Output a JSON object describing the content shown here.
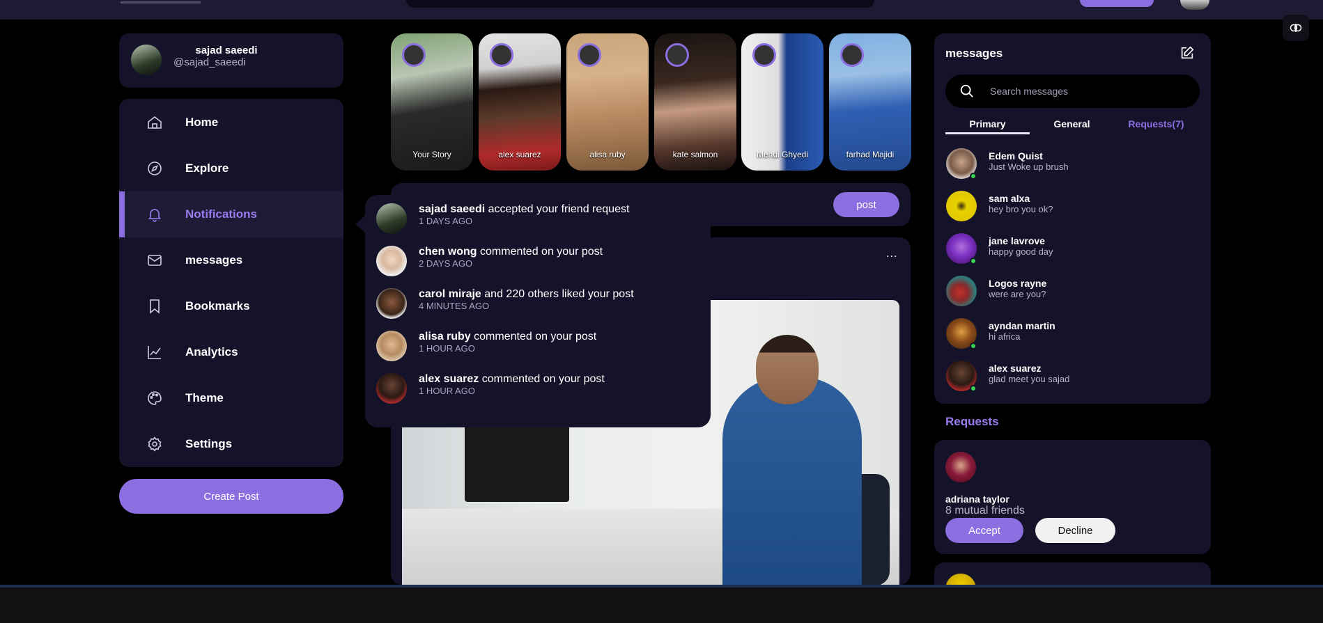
{
  "profile": {
    "name": "sajad saeedi",
    "handle": "@sajad_saeedi"
  },
  "sidebar": {
    "items": [
      {
        "label": "Home",
        "icon": "home-icon"
      },
      {
        "label": "Explore",
        "icon": "compass-icon"
      },
      {
        "label": "Notifications",
        "icon": "bell-icon",
        "active": true
      },
      {
        "label": "messages",
        "icon": "envelope-icon"
      },
      {
        "label": "Bookmarks",
        "icon": "bookmark-icon"
      },
      {
        "label": "Analytics",
        "icon": "chart-line-icon"
      },
      {
        "label": "Theme",
        "icon": "palette-icon"
      },
      {
        "label": "Settings",
        "icon": "gear-icon"
      }
    ],
    "create_label": "Create Post"
  },
  "stories": [
    {
      "name": "Your Story"
    },
    {
      "name": "alex suarez"
    },
    {
      "name": "alisa ruby"
    },
    {
      "name": "kate salmon"
    },
    {
      "name": "Mehdi Ghyedi"
    },
    {
      "name": "farhad Majidi"
    }
  ],
  "composer": {
    "post_label": "post"
  },
  "feed": {
    "menu_label": "..."
  },
  "notifications": [
    {
      "name": "sajad saeedi",
      "text": " accepted your friend request",
      "time": "1 DAYS AGO"
    },
    {
      "name": "chen wong",
      "text": " commented on your post",
      "time": "2 DAYS AGO"
    },
    {
      "name": "carol miraje",
      "text": " and 220 others liked your post",
      "time": "4 MINUTES AGO"
    },
    {
      "name": "alisa ruby",
      "text": " commented on your post",
      "time": "1 HOUR AGO"
    },
    {
      "name": "alex suarez",
      "text": " commented on your post",
      "time": "1 HOUR AGO"
    }
  ],
  "messages": {
    "title": "messages",
    "search_placeholder": "Search messages",
    "tabs": [
      "Primary",
      "General",
      "Requests(7)"
    ],
    "items": [
      {
        "name": "Edem Quist",
        "preview": "Just Woke up brush",
        "online": true
      },
      {
        "name": "sam alxa",
        "preview": "hey bro you ok?",
        "online": false
      },
      {
        "name": "jane lavrove",
        "preview": "happy good day",
        "online": true
      },
      {
        "name": "Logos rayne",
        "preview": "were are you?",
        "online": false
      },
      {
        "name": "ayndan martin",
        "preview": "hi africa",
        "online": true
      },
      {
        "name": "alex suarez",
        "preview": "glad meet you sajad",
        "online": true
      }
    ]
  },
  "requests": {
    "heading": "Requests",
    "items": [
      {
        "name": "adriana taylor",
        "mutual": "8 mutual friends",
        "accept": "Accept",
        "decline": "Decline"
      }
    ]
  },
  "colors": {
    "accent": "#8b6ee0",
    "panel": "#15132a",
    "background": "#000000",
    "online": "#39d353"
  }
}
